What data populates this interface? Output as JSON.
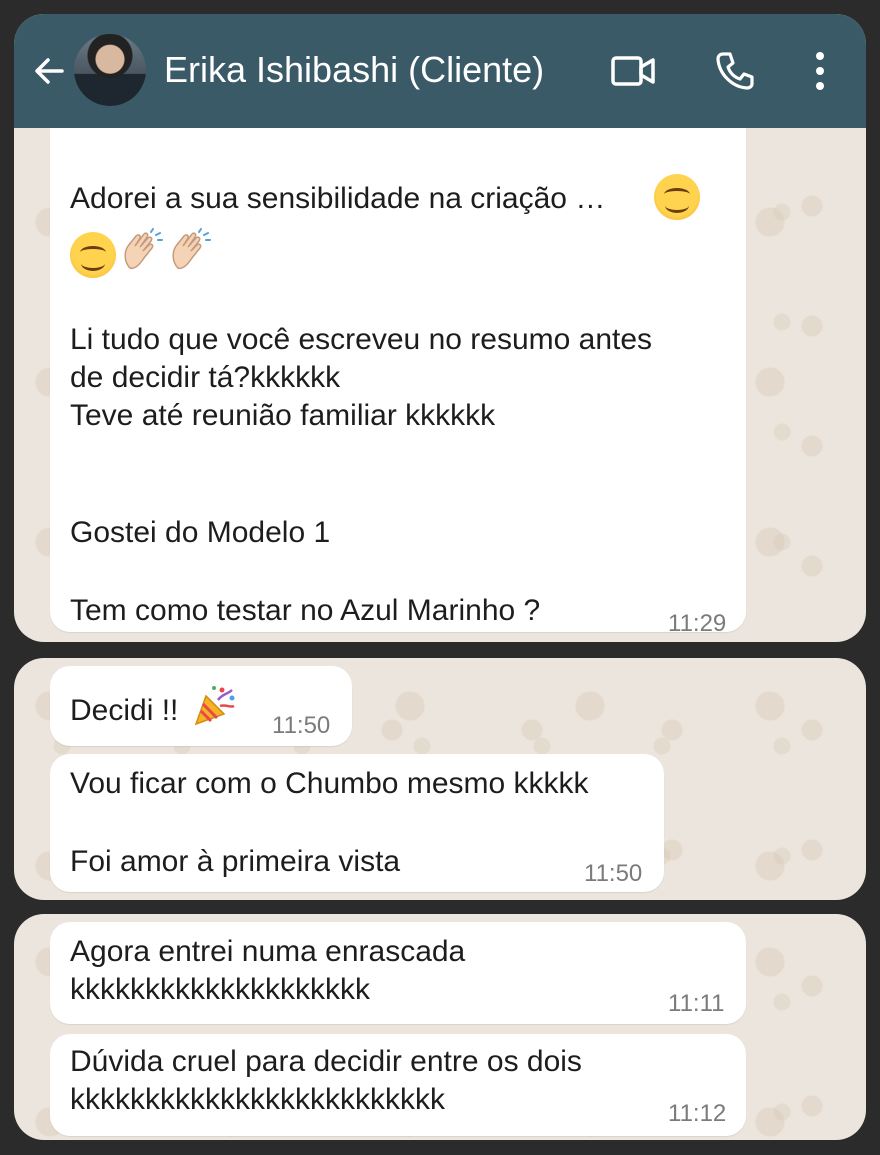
{
  "header": {
    "contact_name": "Erika Ishibashi (Cliente)",
    "colors": {
      "header_bg": "#3b5a68",
      "chat_bg": "#ece5dd",
      "bubble_bg": "#ffffff"
    },
    "icons": [
      "back-arrow-icon",
      "avatar",
      "video-call-icon",
      "phone-icon",
      "more-options-icon"
    ]
  },
  "screenshot1": {
    "message": {
      "line1": "Adorei a sua sensibilidade na criação …",
      "line3": "Li tudo que você escreveu no resumo antes",
      "line4": "de decidir tá?kkkkkk",
      "line5": "Teve até reunião familiar kkkkkk",
      "line6": "Gostei do Modelo 1",
      "line7": "Tem como testar no Azul Marinho ?",
      "time": "11:29",
      "emojis": [
        "smiling-face-icon",
        "smiling-face-icon",
        "clapping-hands-icon",
        "clapping-hands-icon"
      ]
    }
  },
  "screenshot2": {
    "messages": [
      {
        "text": "Decidi !!",
        "emoji": "party-popper-icon",
        "time": "11:50"
      },
      {
        "line1": "Vou ficar com o Chumbo mesmo kkkkk",
        "line2": "Foi amor à primeira vista",
        "time": "11:50"
      }
    ]
  },
  "screenshot3": {
    "messages": [
      {
        "line1": "Agora entrei numa enrascada",
        "line2": "kkkkkkkkkkkkkkkkkkkk",
        "time": "11:11"
      },
      {
        "line1": "Dúvida cruel para decidir entre os dois",
        "line2": "kkkkkkkkkkkkkkkkkkkkkkkkk",
        "time": "11:12"
      }
    ]
  }
}
